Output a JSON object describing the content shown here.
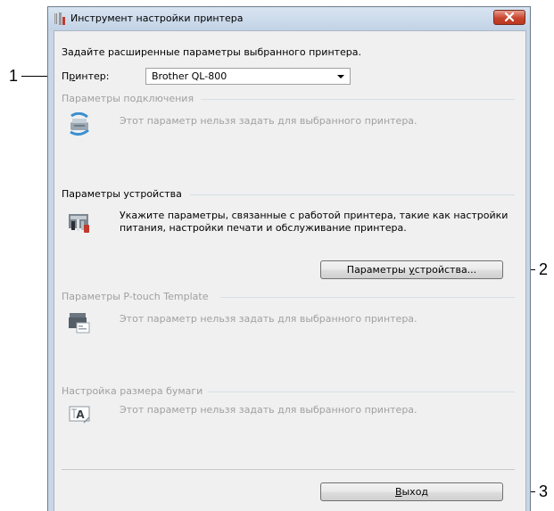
{
  "callouts": [
    "1",
    "2",
    "3"
  ],
  "window": {
    "title": "Инструмент настройки принтера",
    "intro": "Задайте расширенные параметры выбранного принтера.",
    "printer_label_before": "П",
    "printer_label_mnemonic": "р",
    "printer_label_after": "интер:",
    "printer_value": "Brother QL-800"
  },
  "sections": {
    "connection": {
      "title": "Параметры подключения",
      "text": "Этот параметр нельзя задать для выбранного принтера."
    },
    "device": {
      "title": "Параметры устройства",
      "text_line1": "Укажите параметры, связанные с работой принтера, такие как настройки",
      "text_line2": "питания, настройки печати и обслуживание принтера.",
      "button_before": "Параметры ",
      "button_mnemonic": "у",
      "button_after": "стройства..."
    },
    "ptouch": {
      "title": "Параметры P-touch Template",
      "text": "Этот параметр нельзя задать для выбранного принтера."
    },
    "paper": {
      "title": "Настройка размера бумаги",
      "text": "Этот параметр нельзя задать для выбранного принтера."
    }
  },
  "footer": {
    "exit_mnemonic": "В",
    "exit_after": "ыход"
  }
}
